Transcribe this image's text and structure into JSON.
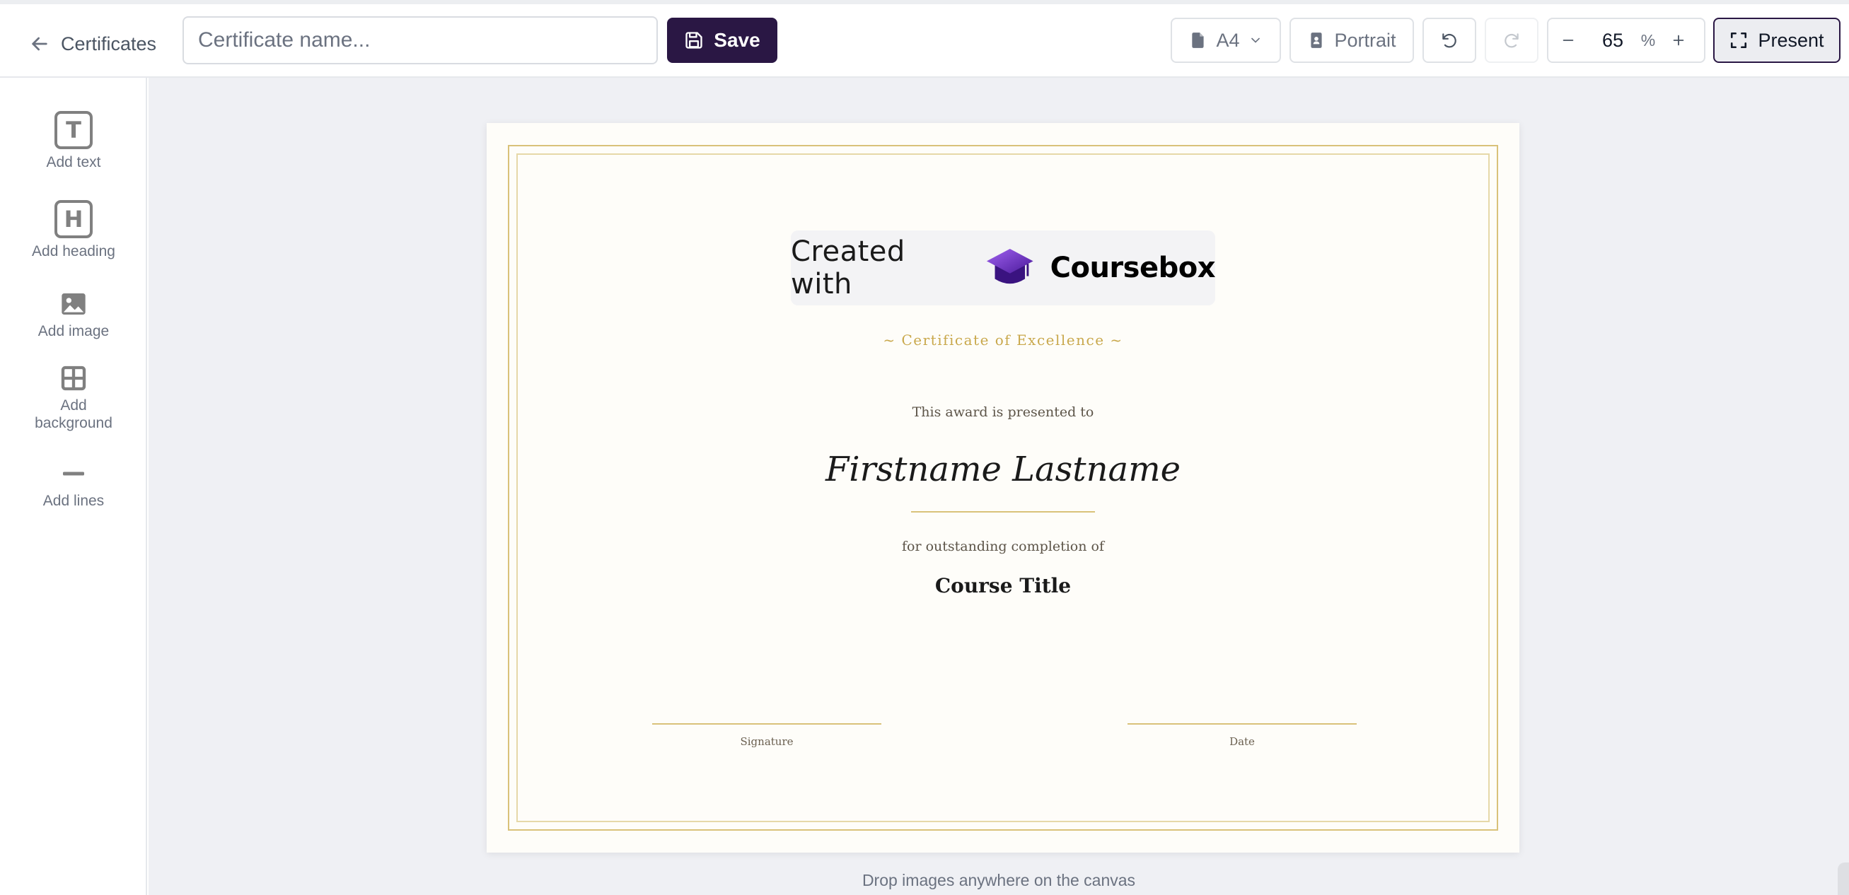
{
  "header": {
    "back_label": "Certificates",
    "name_placeholder": "Certificate name...",
    "name_value": "",
    "save_label": "Save",
    "page_size": "A4",
    "orientation": "Portrait",
    "zoom_value": "65",
    "zoom_unit": "%",
    "present_label": "Present"
  },
  "sidebar": {
    "tools": [
      {
        "label": "Add text",
        "icon": "T"
      },
      {
        "label": "Add heading",
        "icon": "H"
      },
      {
        "label": "Add image"
      },
      {
        "label": "Add background"
      },
      {
        "label": "Add lines"
      }
    ]
  },
  "certificate": {
    "badge_text": "Created with",
    "badge_brand": "Coursebox",
    "subtitle": "~ Certificate of Excellence ~",
    "presented_to": "This award is presented to",
    "recipient": "Firstname Lastname",
    "completion_text": "for outstanding completion of",
    "course_title": "Course Title",
    "signature_label": "Signature",
    "date_label": "Date"
  },
  "canvas": {
    "drop_hint": "Drop images anywhere on the canvas"
  },
  "colors": {
    "primary": "#2a1744",
    "gold": "#c9a84c",
    "frame": "#d9c27a",
    "canvas_bg": "#eff0f4",
    "page_bg": "#fefdf9",
    "brand_purple": "#7b3fe4"
  }
}
